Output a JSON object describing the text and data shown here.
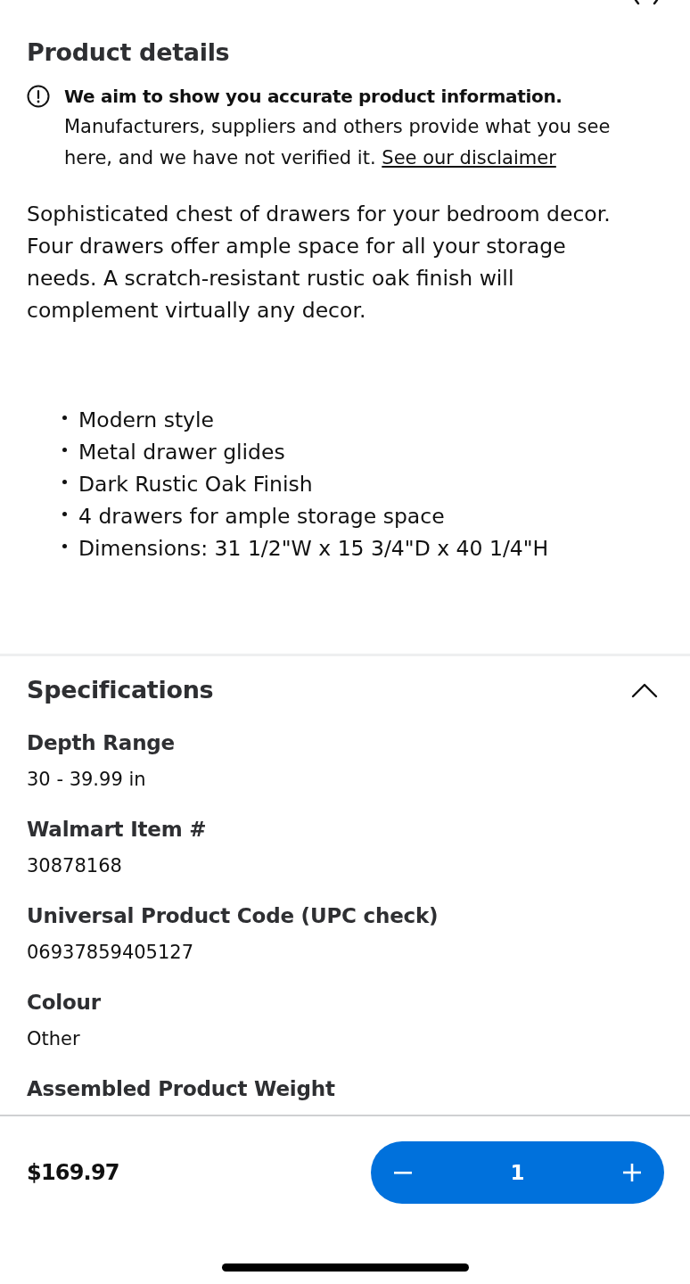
{
  "product_details": {
    "title": "Product details",
    "notice": {
      "heading": "We aim to show you accurate product information.",
      "body": "Manufacturers, suppliers and others provide what you see here, and we have not verified it.",
      "link": "See our disclaimer"
    },
    "description": "Sophisticated chest of drawers for your bedroom decor. Four drawers offer ample space for all your storage needs. A scratch-resistant rustic oak finish will complement virtually any decor.",
    "bullets": [
      "Modern style",
      "Metal drawer glides",
      "Dark Rustic Oak Finish",
      "4 drawers for ample storage space",
      "Dimensions: 31 1/2\"W x 15 3/4\"D x 40 1/4\"H"
    ]
  },
  "specifications": {
    "title": "Specifications",
    "expanded": true,
    "items": [
      {
        "label": "Depth Range",
        "value": "30 - 39.99 in"
      },
      {
        "label": "Walmart Item #",
        "value": "30878168"
      },
      {
        "label": "Universal Product Code (UPC check)",
        "value": "06937859405127"
      },
      {
        "label": "Colour",
        "value": "Other"
      },
      {
        "label": "Assembled Product Weight"
      }
    ]
  },
  "bottom_bar": {
    "price": "$169.97",
    "quantity": "1"
  }
}
